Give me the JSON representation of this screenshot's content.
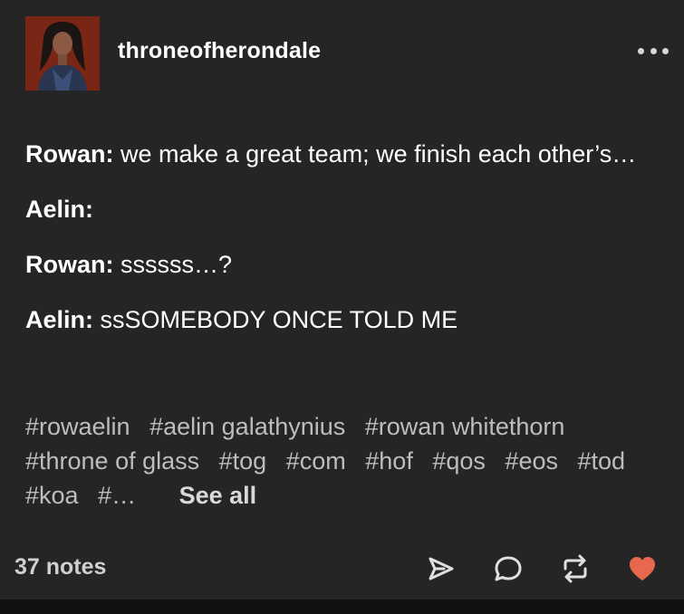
{
  "post": {
    "username": "throneofherondale",
    "avatar_icon": "avatar-portrait",
    "more_icon": "more-dots-icon"
  },
  "dialogue": [
    {
      "speaker": "Rowan:",
      "line": "we make a great team; we finish each other’s…"
    },
    {
      "speaker": "Aelin:",
      "line": ""
    },
    {
      "speaker": "Rowan:",
      "line": "ssssss…?"
    },
    {
      "speaker": "Aelin:",
      "line": "ssSOMEBODY ONCE TOLD ME"
    }
  ],
  "tags": [
    "#rowaelin",
    "#aelin galathynius",
    "#rowan whitethorn",
    "#throne of glass",
    "#tog",
    "#com",
    "#hof",
    "#qos",
    "#eos",
    "#tod",
    "#koa",
    "#…"
  ],
  "see_all": "See all",
  "footer": {
    "notes": "37 notes",
    "icons": [
      "share-icon",
      "reply-icon",
      "reblog-icon",
      "like-heart-icon"
    ],
    "like_color": "#e8684f"
  }
}
